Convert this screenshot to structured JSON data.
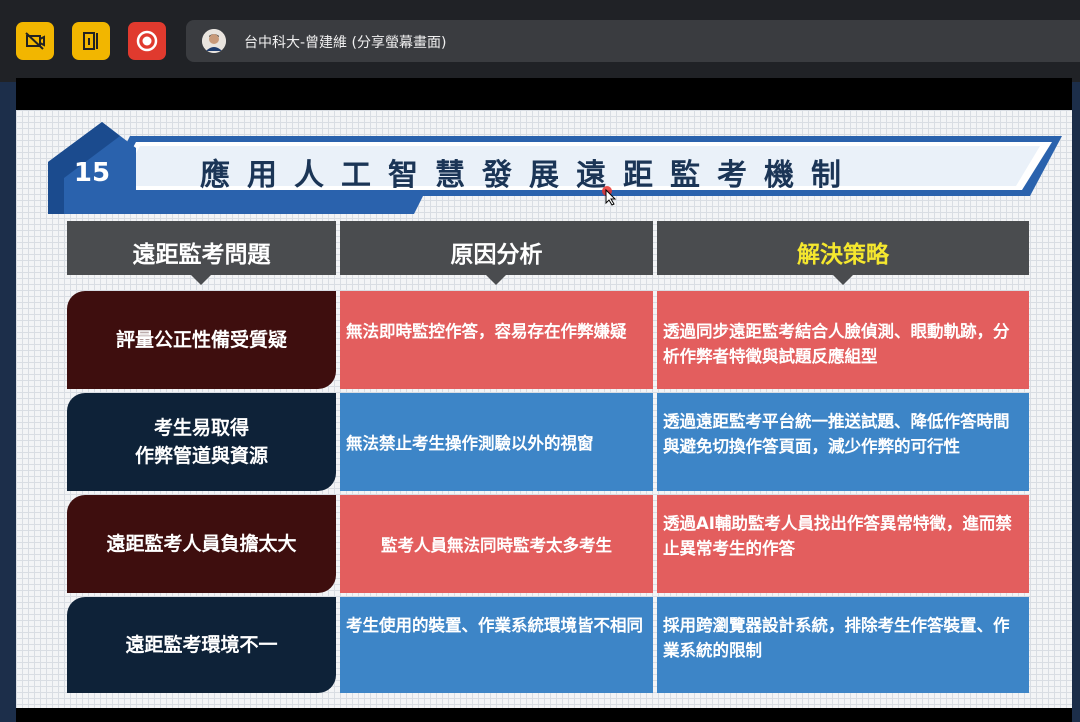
{
  "toolbar": {
    "buttons": [
      {
        "icon": "hide-video-icon",
        "color": "#f2b600"
      },
      {
        "icon": "exit-door-icon",
        "color": "#f2b600"
      },
      {
        "icon": "record-icon",
        "color": "#e03a2e"
      }
    ],
    "share_title": "台中科大-曾建維 (分享螢幕畫面)"
  },
  "slide": {
    "number": "15",
    "title": "應用人工智慧發展遠距監考機制",
    "headers": {
      "problem": "遠距監考問題",
      "reason": "原因分析",
      "solution": "解決策略"
    },
    "rows": [
      {
        "problem": "評量公正性備受質疑",
        "reason": "無法即時監控作答，容易存在作弊嫌疑",
        "solution": "透過同步遠距監考結合人臉偵測、眼動軌跡，分析作弊者特徵與試題反應組型"
      },
      {
        "problem_line1": "考生易取得",
        "problem_line2": "作弊管道與資源",
        "reason": "無法禁止考生操作測驗以外的視窗",
        "solution": "透過遠距監考平台統一推送試題、降低作答時間與避免切換作答頁面，減少作弊的可行性"
      },
      {
        "problem": "遠距監考人員負擔太大",
        "reason": "監考人員無法同時監考太多考生",
        "solution": "透過AI輔助監考人員找出作答異常特徵，進而禁止異常考生的作答"
      },
      {
        "problem": "遠距監考環境不一",
        "reason": "考生使用的裝置、作業系統環境皆不相同",
        "solution": "採用跨瀏覽器設計系統，排除考生作答裝置、作業系統的限制"
      }
    ],
    "colors": {
      "red_cell": "#e35e5e",
      "blue_cell": "#3d85c7",
      "dark_red": "#3e0e0e",
      "dark_blue": "#0e2238",
      "header_gray": "#4a4c4f",
      "highlight_yellow": "#f5e72e"
    }
  }
}
